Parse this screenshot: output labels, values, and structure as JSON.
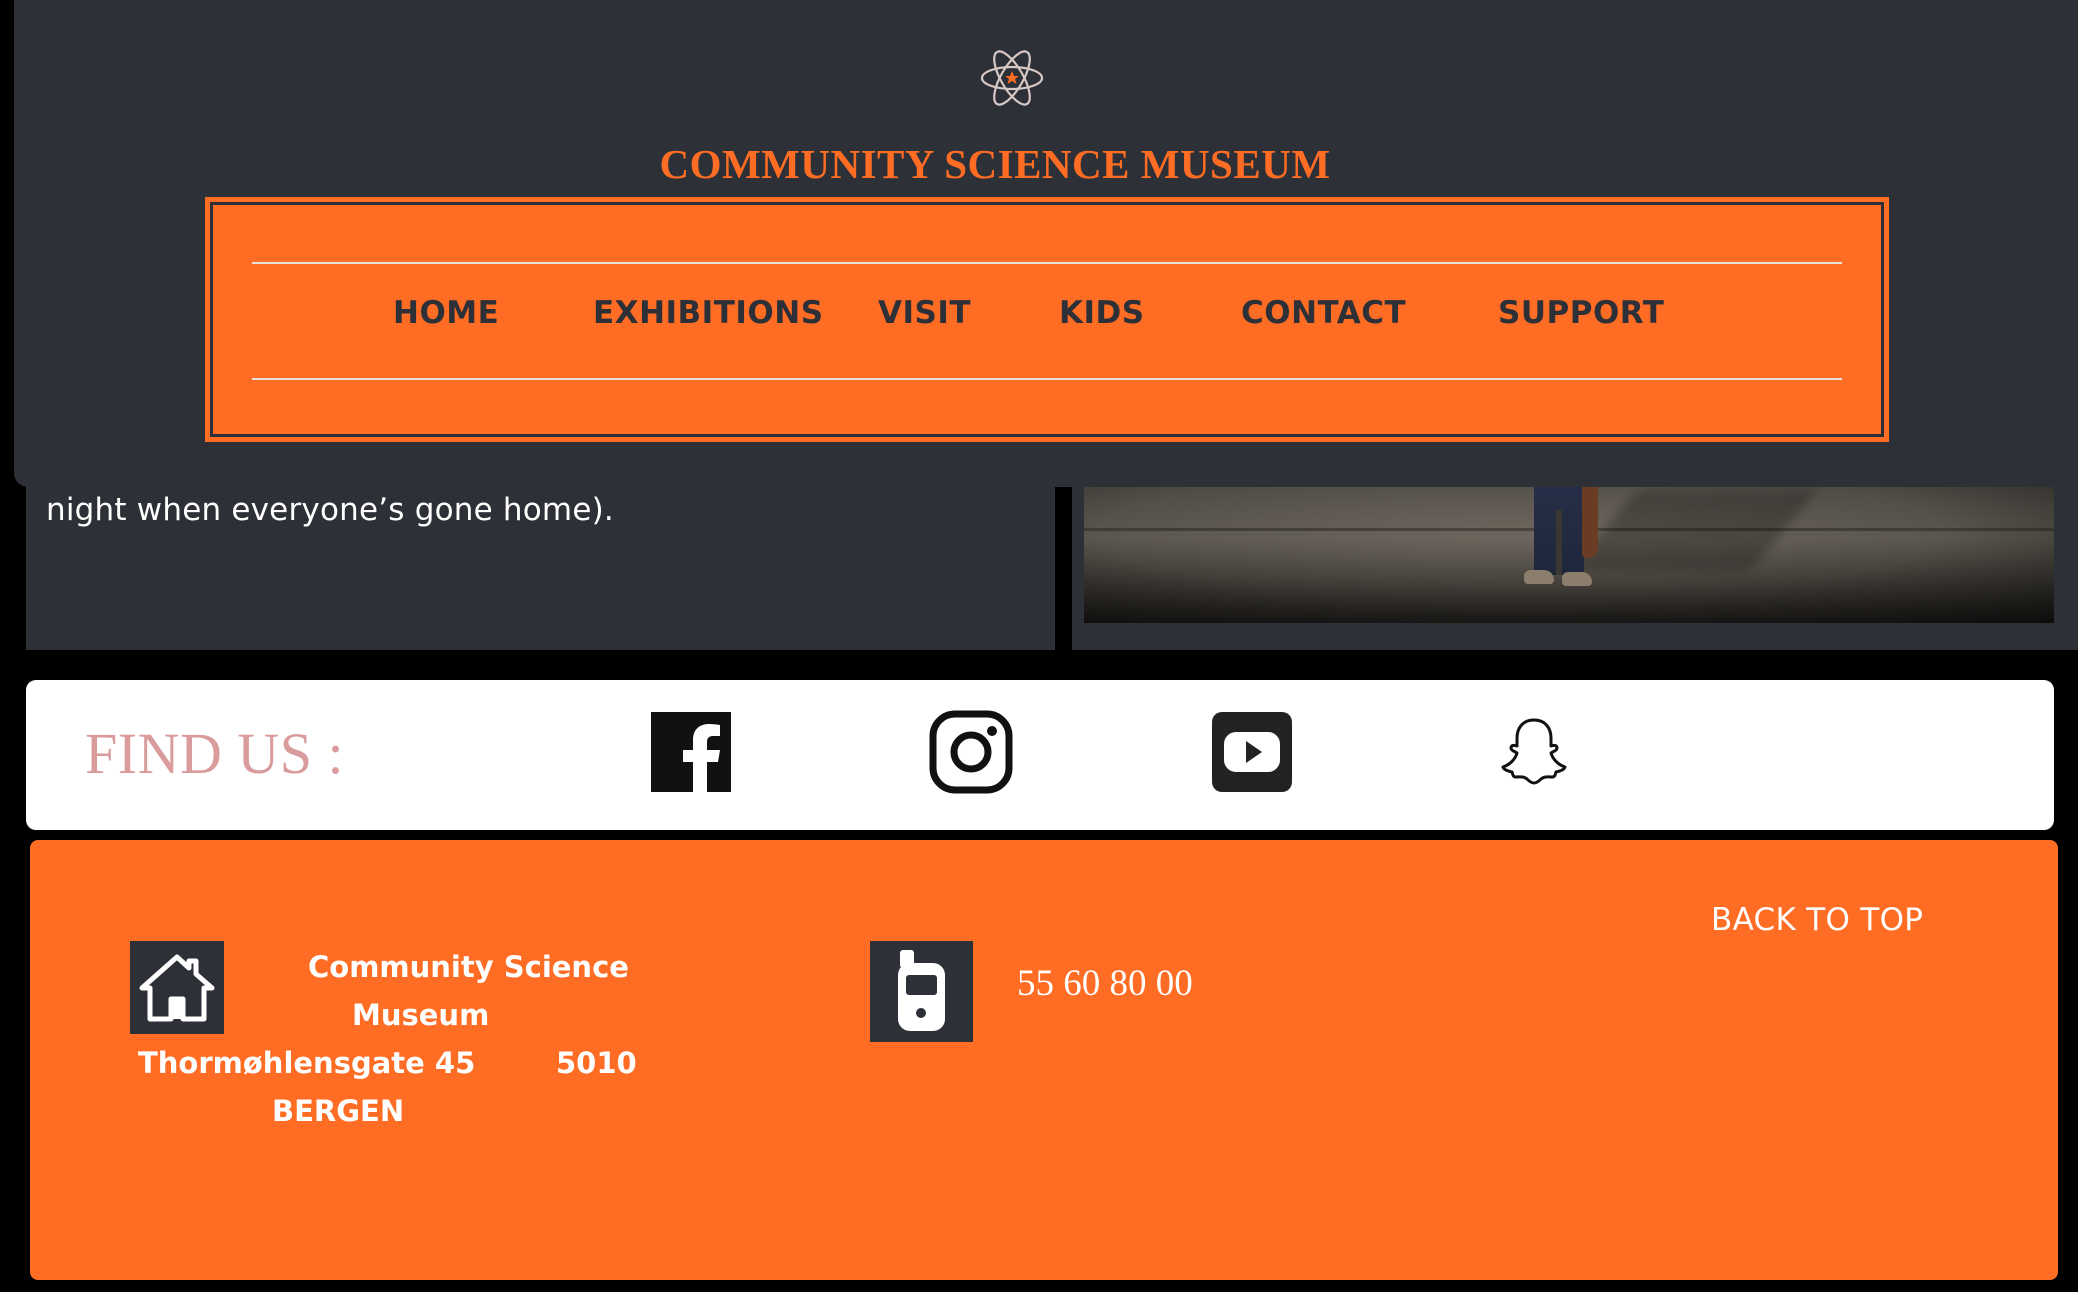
{
  "header": {
    "logo_icon": "atom-icon",
    "title": "COMMUNITY SCIENCE MUSEUM",
    "nav": [
      {
        "label": "HOME"
      },
      {
        "label": "EXHIBITIONS"
      },
      {
        "label": "VISIT"
      },
      {
        "label": "KIDS"
      },
      {
        "label": "CONTACT"
      },
      {
        "label": "SUPPORT"
      }
    ]
  },
  "content": {
    "text_tail": "night when everyone’s gone home)."
  },
  "find_us": {
    "label": "FIND US :",
    "icons": [
      "facebook-icon",
      "instagram-icon",
      "youtube-icon",
      "snapchat-icon"
    ]
  },
  "footer": {
    "address": {
      "line1": "Community Science",
      "line2": "Museum",
      "street": "Thormøhlensgate 45",
      "postcode": "5010",
      "city": "BERGEN"
    },
    "phone": "55 60 80 00",
    "back_to_top": "BACK TO TOP"
  },
  "colors": {
    "accent": "#ff6c23",
    "dark": "#2e3038",
    "find_us_label": "#d99b9b"
  }
}
